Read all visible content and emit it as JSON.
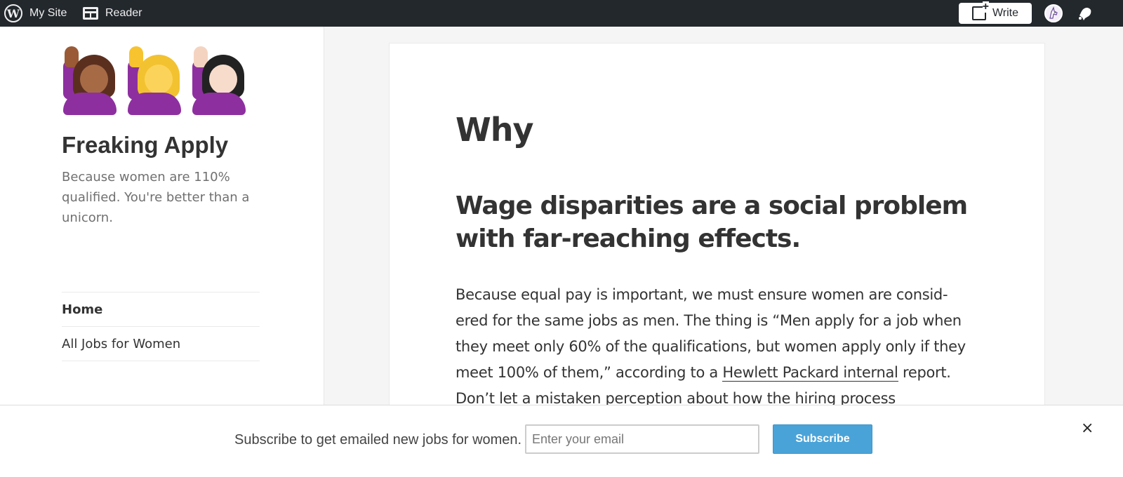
{
  "adminbar": {
    "mysite_label": "My Site",
    "reader_label": "Reader",
    "write_label": "Write",
    "avatar_icon": "unicorn-avatar-icon",
    "notifications_icon": "bell-icon",
    "colors": {
      "background": "#23282d",
      "text": "#eeeeee"
    }
  },
  "sidebar": {
    "emoji": [
      "woman-raising-hand-medium-dark",
      "woman-raising-hand-yellow",
      "woman-raising-hand-light"
    ],
    "site_title": "Freaking Apply",
    "tagline": "Because women are 110% qualified. You're better than a unicorn.",
    "nav": [
      {
        "label": "Home",
        "active": true
      },
      {
        "label": "All Jobs for Women",
        "active": false
      }
    ]
  },
  "main": {
    "title": "Why",
    "subheading": "Wage disparities are a social problem with far-reaching effects.",
    "body_before_link": "Because equal pay is important, we must ensure women are consid-ered for the same jobs as men. The thing is “Men apply for a job when they meet only 60% of the qualifications, but women apply only if they meet 100% of them,” according to a ",
    "body_link": "Hewlett Packard internal",
    "body_after_link": " report. Don’t let a mistaken perception about how the hiring process"
  },
  "subscribe": {
    "prompt": "Subscribe to get emailed new jobs for women.",
    "email_placeholder": "Enter your email",
    "email_value": "",
    "button_label": "Subscribe",
    "close_label": "×",
    "button_color": "#4aa3d8"
  }
}
